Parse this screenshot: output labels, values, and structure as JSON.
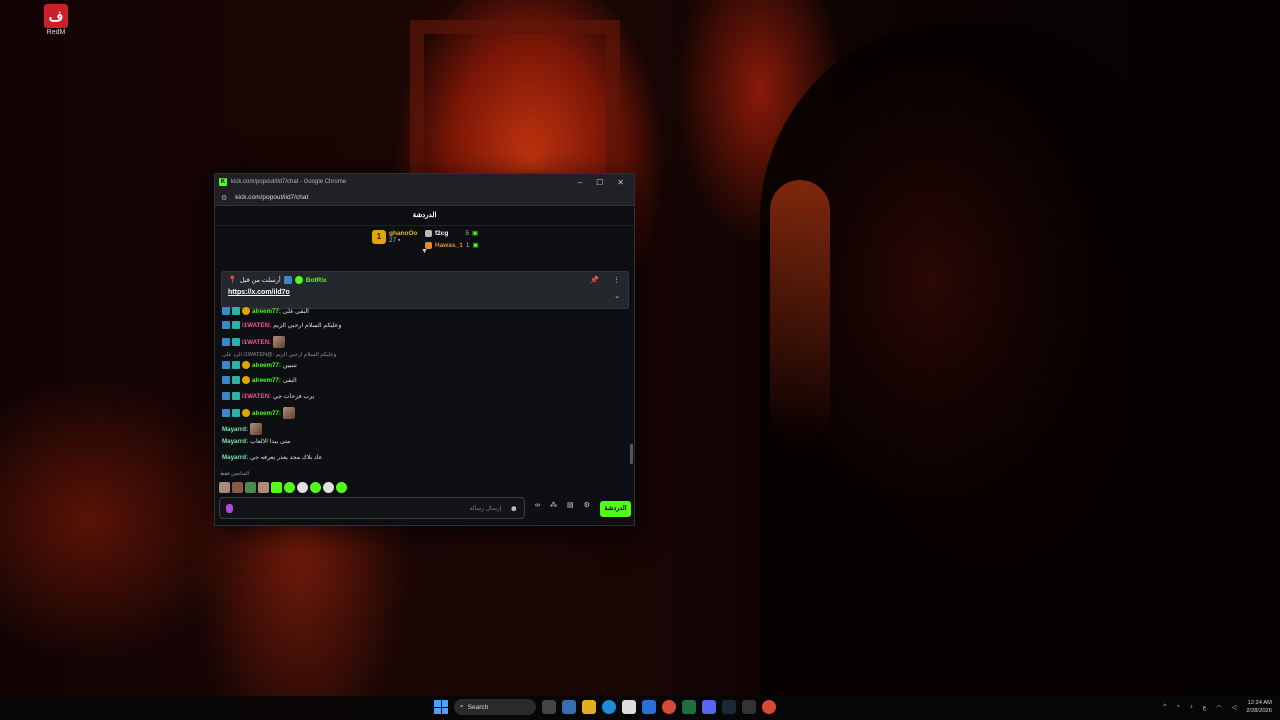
{
  "desktop": {
    "icon_label": "RedM",
    "icon_glyph": "ف"
  },
  "browser": {
    "window_title": "kick.com/popout/ild7/chat - Google Chrome",
    "url": "kick.com/popout/ild7/chat",
    "controls": [
      "–",
      "☐",
      "✕"
    ]
  },
  "chat": {
    "header": "الدردشة",
    "leaderboard": {
      "first": {
        "rank": "1",
        "name": "ghanoOo",
        "count": "27"
      },
      "second": {
        "name": "f2cg",
        "count": "5"
      },
      "third": {
        "name": "Hawas_1",
        "count": "1"
      }
    },
    "pinned": {
      "sender": "BotRix",
      "pinned_by_label": "أرسلت من قبل",
      "link": "https://x.com/ild7o"
    },
    "messages": [
      {
        "user": "alreem77:",
        "text": "البقى غلى",
        "style": "u-gold"
      },
      {
        "user": "i1WATEN:",
        "text": "وعليكم السلام ارحبي الزيم",
        "style": "u-pink"
      },
      {
        "user": "i1WATEN:",
        "text": "",
        "style": "u-pink",
        "emote": true
      },
      {
        "reply": "الرد على i1WATEN@: وعليكم السلام ارحبي الزيم"
      },
      {
        "user": "alreem77:",
        "text": "تنبيين",
        "style": "u-gold"
      },
      {
        "user": "alreem77:",
        "text": "البقى",
        "style": "u-gold"
      },
      {
        "user": "i1WATEN:",
        "text": "يرب فرحات جي",
        "style": "u-pink"
      },
      {
        "user": "alreem77:",
        "text": "",
        "style": "u-gold",
        "emote": true
      },
      {
        "user": "Mayarrd:",
        "text": "",
        "style": "u-mint",
        "emote": true
      },
      {
        "user": "Mayarrd:",
        "text": "متى يبدا الالعاب",
        "style": "u-mint"
      },
      {
        "user": "Mayarrd:",
        "text": "عاد بلاك محد يعذر يعرفه جي",
        "style": "u-mint"
      }
    ],
    "recent_label": "المتابعين فقط",
    "input_placeholder": "إرسال رسالة",
    "send_button": "الدردشة"
  },
  "taskbar": {
    "search_label": "Search",
    "language": "ع",
    "time": "12:24 AM",
    "date": "2/28/2026"
  },
  "colors": {
    "kick_green": "#53fc18",
    "gold": "#e4a400",
    "pink_user": "#f25590"
  }
}
